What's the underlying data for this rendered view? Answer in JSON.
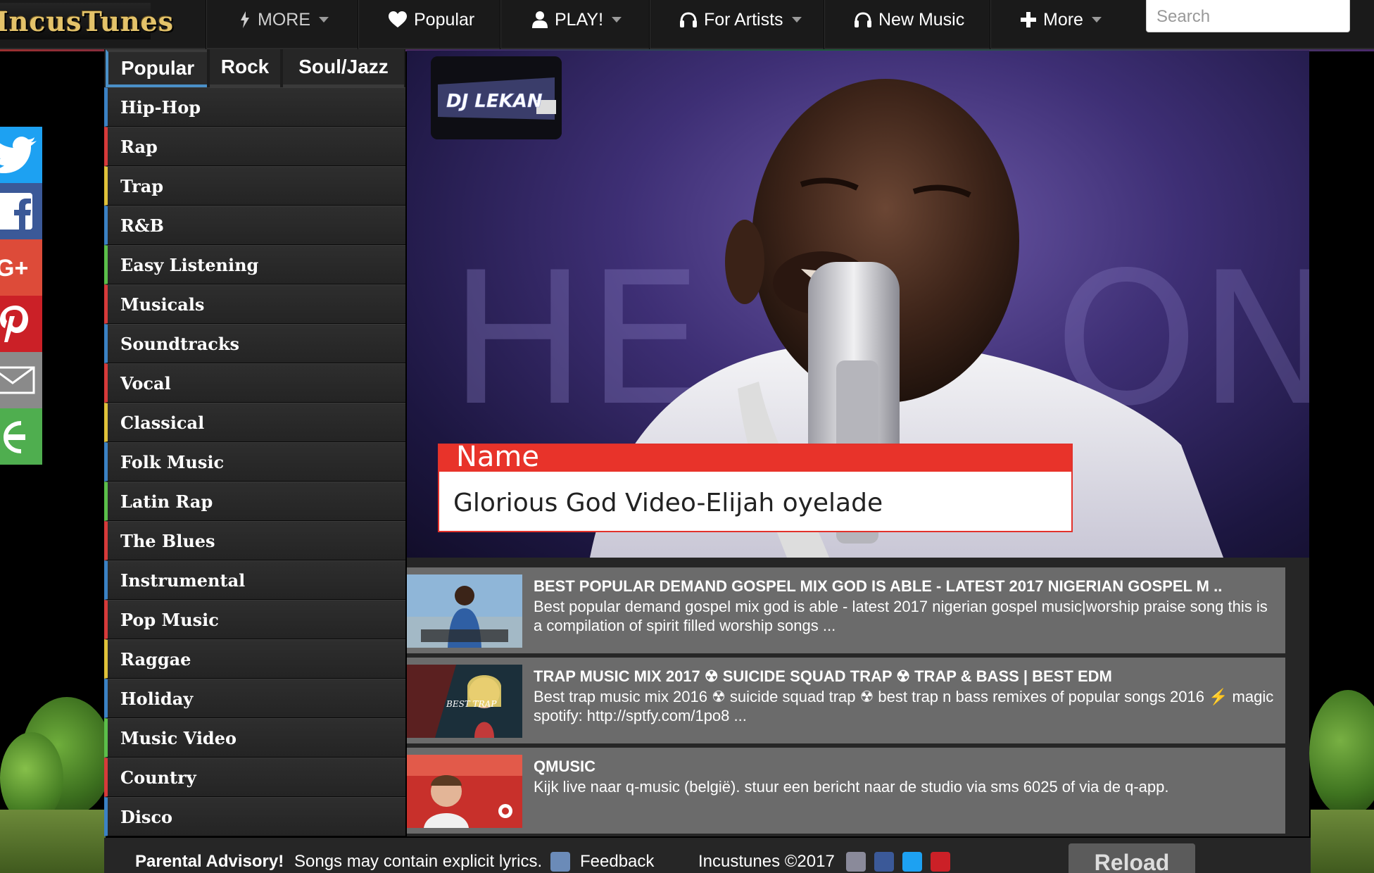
{
  "logo": "IncusTunes",
  "nav": {
    "items": [
      {
        "label": "MORE",
        "icon": "bolt-icon"
      },
      {
        "label": "Popular",
        "icon": "heart-icon"
      },
      {
        "label": "PLAY!",
        "icon": "user-icon"
      },
      {
        "label": "For Artists",
        "icon": "headphones-icon"
      },
      {
        "label": "New Music",
        "icon": "headphones-icon"
      },
      {
        "label": "More",
        "icon": "plus-icon"
      }
    ],
    "search_placeholder": "Search"
  },
  "social": [
    {
      "name": "twitter-icon",
      "color": "#1da1f2"
    },
    {
      "name": "facebook-icon",
      "color": "#3b5998"
    },
    {
      "name": "google-plus-icon",
      "color": "#dd4b39"
    },
    {
      "name": "pinterest-icon",
      "color": "#cb2027"
    },
    {
      "name": "email-icon",
      "color": "#8a8a8a"
    },
    {
      "name": "share-icon",
      "color": "#4fae4f"
    }
  ],
  "tabs": [
    "Popular",
    "Rock",
    "Soul/Jazz"
  ],
  "genres": [
    {
      "label": "Hip-Hop",
      "color": "#3b82c4"
    },
    {
      "label": "Rap",
      "color": "#d63a3a"
    },
    {
      "label": "Trap",
      "color": "#e0c23a"
    },
    {
      "label": "R&B",
      "color": "#3b82c4"
    },
    {
      "label": "Easy Listening",
      "color": "#5bbf4a"
    },
    {
      "label": "Musicals",
      "color": "#d63a3a"
    },
    {
      "label": "Soundtracks",
      "color": "#3b82c4"
    },
    {
      "label": "Vocal",
      "color": "#d63a3a"
    },
    {
      "label": "Classical",
      "color": "#e0c23a"
    },
    {
      "label": "Folk Music",
      "color": "#3b82c4"
    },
    {
      "label": "Latin Rap",
      "color": "#5bbf4a"
    },
    {
      "label": "The Blues",
      "color": "#d63a3a"
    },
    {
      "label": "Instrumental",
      "color": "#3b82c4"
    },
    {
      "label": "Pop Music",
      "color": "#d63a3a"
    },
    {
      "label": "Raggae",
      "color": "#e0c23a"
    },
    {
      "label": "Holiday",
      "color": "#3b82c4"
    },
    {
      "label": "Music Video",
      "color": "#5bbf4a"
    },
    {
      "label": "Country",
      "color": "#d63a3a"
    },
    {
      "label": "Disco",
      "color": "#3b82c4"
    }
  ],
  "video": {
    "logo_text": "DJ LEKAN",
    "name_label": "Name",
    "name_value": "Glorious God Video-Elijah oyelade"
  },
  "results": [
    {
      "title": "BEST POPULAR DEMAND GOSPEL MIX GOD IS ABLE - LATEST 2017 NIGERIAN GOSPEL M ..",
      "desc": "Best popular demand gospel mix god is able - latest 2017 nigerian gospel music|worship praise song this is a compilation of spirit filled worship songs ...",
      "thumb_text": ""
    },
    {
      "title": "TRAP MUSIC MIX 2017 ☢ SUICIDE SQUAD TRAP ☢ TRAP & BASS | BEST EDM",
      "desc": "Best trap music mix 2016 ☢ suicide squad trap ☢ best trap n bass remixes of popular songs 2016 ⚡ magic spotify: http://sptfy.com/1po8 ...",
      "thumb_text": "BEST TRAP"
    },
    {
      "title": "QMUSIC",
      "desc": "Kijk live naar q-music (belgië). stuur een bericht naar de studio via sms 6025 of via de q-app.",
      "thumb_text": ""
    }
  ],
  "footer": {
    "advisory_bold": "Parental Advisory!",
    "advisory_text": "Songs may contain explicit lyrics.",
    "feedback": "Feedback",
    "copyright": "Incustunes ©2017",
    "reload": "Reload"
  }
}
